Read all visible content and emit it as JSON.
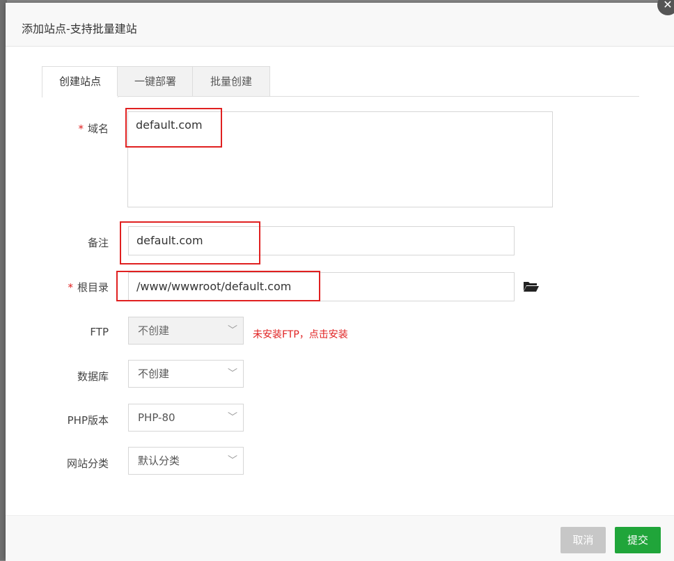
{
  "dialog": {
    "title": "添加站点-支持批量建站",
    "close_glyph": "✕"
  },
  "tabs": [
    {
      "label": "创建站点",
      "active": true
    },
    {
      "label": "一键部署",
      "active": false
    },
    {
      "label": "批量创建",
      "active": false
    }
  ],
  "form": {
    "required_mark": "*",
    "domain": {
      "label": "域名",
      "value": "default.com"
    },
    "remark": {
      "label": "备注",
      "value": "default.com"
    },
    "root": {
      "label": "根目录",
      "value": "/www/wwwroot/default.com",
      "icon": "folder-open-icon"
    },
    "ftp": {
      "label": "FTP",
      "value": "不创建",
      "disabled": true,
      "hint": "未安装FTP，点击安装"
    },
    "database": {
      "label": "数据库",
      "value": "不创建"
    },
    "php": {
      "label": "PHP版本",
      "value": "PHP-80"
    },
    "category": {
      "label": "网站分类",
      "value": "默认分类"
    }
  },
  "footer": {
    "cancel_label": "取消",
    "submit_label": "提交"
  },
  "colors": {
    "accent_green": "#20a53a",
    "cancel_gray": "#c7c7c7",
    "highlight_red": "#e02020"
  }
}
